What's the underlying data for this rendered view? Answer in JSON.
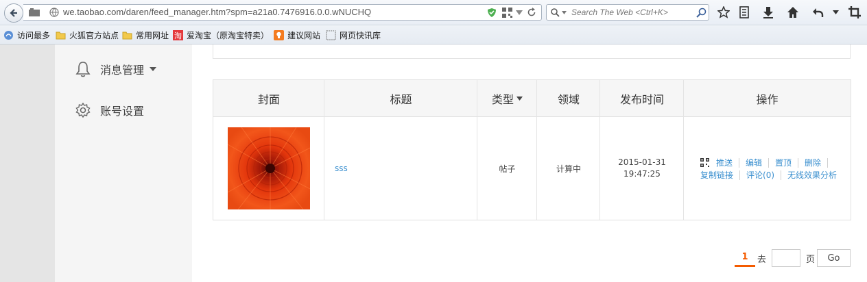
{
  "browser": {
    "url": "we.taobao.com/daren/feed_manager.htm?spm=a21a0.7476916.0.0.wNUCHQ",
    "search_placeholder": "Search The Web <Ctrl+K>"
  },
  "bookmarks": [
    {
      "label": "访问最多",
      "icon": "globe-icon"
    },
    {
      "label": "火狐官方站点",
      "icon": "folder-icon"
    },
    {
      "label": "常用网址",
      "icon": "folder-icon"
    },
    {
      "label": "爱淘宝（原淘宝特卖）",
      "icon": "taobao-icon"
    },
    {
      "label": "建议网站",
      "icon": "bulb-icon"
    },
    {
      "label": "网页快讯库",
      "icon": "webslice-icon"
    }
  ],
  "sidebar": {
    "messages_label": "消息管理",
    "account_label": "账号设置"
  },
  "table": {
    "headers": {
      "cover": "封面",
      "title": "标题",
      "type": "类型",
      "domain": "领域",
      "time": "发布时间",
      "actions": "操作"
    },
    "row": {
      "title": "sss",
      "type": "帖子",
      "domain": "计算中",
      "date": "2015-01-31",
      "time": "19:47:25",
      "actions": [
        "推送",
        "编辑",
        "置顶",
        "删除",
        "复制链接",
        "评论(0)",
        "无线效果分析"
      ]
    }
  },
  "pagination": {
    "current": "1",
    "goto_label": "去",
    "page_label": "页",
    "go_button": "Go"
  },
  "colors": {
    "link": "#3a8fcf",
    "accent": "#f45b00"
  }
}
